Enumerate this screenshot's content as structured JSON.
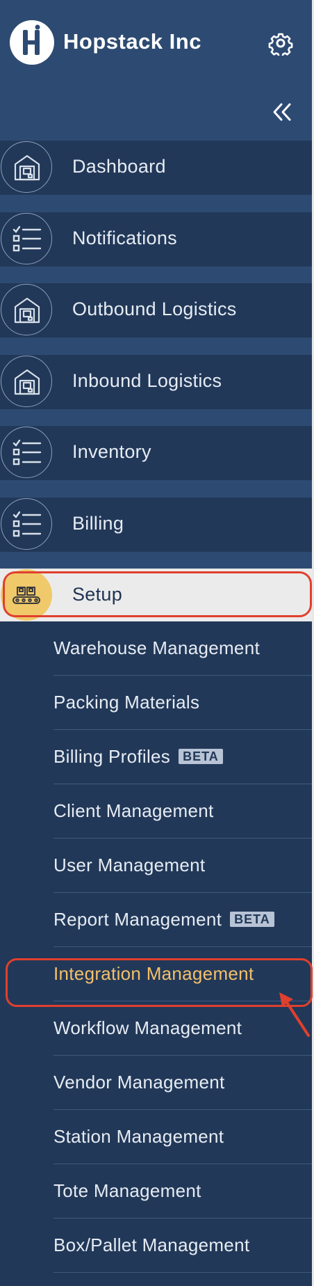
{
  "header": {
    "company_name": "Hopstack Inc",
    "logo_letter": "H",
    "settings_icon": "gear-icon",
    "collapse_icon": "double-chevron-left-icon"
  },
  "nav": {
    "items": [
      {
        "label": "Dashboard",
        "icon": "warehouse-icon"
      },
      {
        "label": "Notifications",
        "icon": "checklist-icon"
      },
      {
        "label": "Outbound Logistics",
        "icon": "warehouse-icon"
      },
      {
        "label": "Inbound Logistics",
        "icon": "warehouse-icon"
      },
      {
        "label": "Inventory",
        "icon": "checklist-icon"
      },
      {
        "label": "Billing",
        "icon": "checklist-icon"
      },
      {
        "label": "Setup",
        "icon": "conveyor-icon",
        "active": true
      }
    ]
  },
  "submenu": {
    "items": [
      {
        "label": "Warehouse Management"
      },
      {
        "label": "Packing Materials"
      },
      {
        "label": "Billing Profiles",
        "badge": "BETA"
      },
      {
        "label": "Client Management"
      },
      {
        "label": "User Management"
      },
      {
        "label": "Report Management",
        "badge": "BETA"
      },
      {
        "label": "Integration Management",
        "selected": true
      },
      {
        "label": "Workflow Management"
      },
      {
        "label": "Vendor Management"
      },
      {
        "label": "Station Management"
      },
      {
        "label": "Tote Management"
      },
      {
        "label": "Box/Pallet Management"
      }
    ]
  },
  "colors": {
    "sidebar_bg": "#2d4b72",
    "item_bg": "#223858",
    "active_bg": "#ebebeb",
    "accent_yellow": "#f3c06b",
    "highlight_red": "#e0402d"
  }
}
